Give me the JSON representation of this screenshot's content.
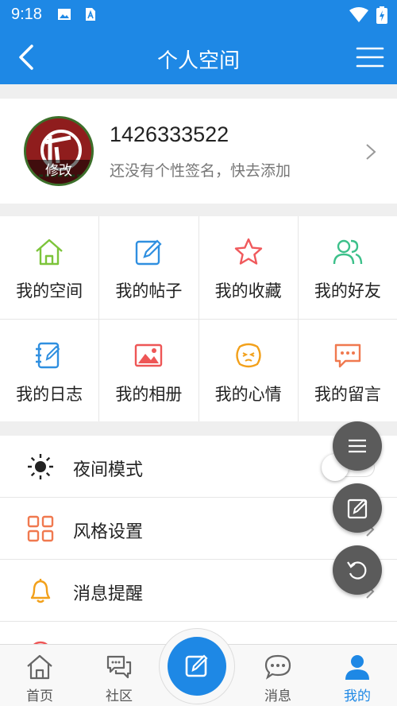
{
  "status_bar": {
    "time": "9:18"
  },
  "header": {
    "title": "个人空间"
  },
  "profile": {
    "user_id": "1426333522",
    "signature": "还没有个性签名，快去添加",
    "avatar_edit_label": "修改"
  },
  "grid": {
    "items": [
      {
        "label": "我的空间",
        "icon": "home-icon",
        "color": "#7cc43a"
      },
      {
        "label": "我的帖子",
        "icon": "edit-icon",
        "color": "#2f8fe0"
      },
      {
        "label": "我的收藏",
        "icon": "star-icon",
        "color": "#f0595c"
      },
      {
        "label": "我的好友",
        "icon": "friends-icon",
        "color": "#3cc08a"
      },
      {
        "label": "我的日志",
        "icon": "diary-icon",
        "color": "#2f8fe0"
      },
      {
        "label": "我的相册",
        "icon": "album-icon",
        "color": "#ee5656"
      },
      {
        "label": "我的心情",
        "icon": "mood-icon",
        "color": "#f2a01a"
      },
      {
        "label": "我的留言",
        "icon": "message-icon",
        "color": "#f0794f"
      }
    ]
  },
  "settings": {
    "items": [
      {
        "label": "夜间模式",
        "icon": "sun-icon"
      },
      {
        "label": "风格设置",
        "icon": "grid-style-icon",
        "color": "#f0794f"
      },
      {
        "label": "消息提醒",
        "icon": "bell-icon",
        "color": "#f2a01a"
      }
    ]
  },
  "tabs": [
    {
      "label": "首页",
      "icon": "home-tab-icon"
    },
    {
      "label": "社区",
      "icon": "community-icon"
    },
    {
      "label": "消息",
      "icon": "chat-icon"
    },
    {
      "label": "我的",
      "icon": "profile-icon",
      "active": true
    }
  ],
  "colors": {
    "primary": "#1e88e5",
    "fab": "#5b5b5b"
  }
}
